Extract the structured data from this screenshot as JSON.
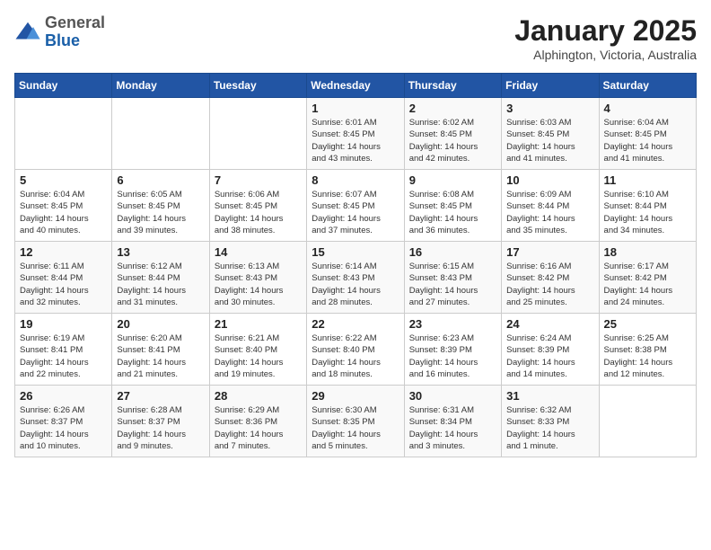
{
  "logo": {
    "general": "General",
    "blue": "Blue"
  },
  "title": "January 2025",
  "subtitle": "Alphington, Victoria, Australia",
  "days_of_week": [
    "Sunday",
    "Monday",
    "Tuesday",
    "Wednesday",
    "Thursday",
    "Friday",
    "Saturday"
  ],
  "weeks": [
    [
      {
        "day": "",
        "info": ""
      },
      {
        "day": "",
        "info": ""
      },
      {
        "day": "",
        "info": ""
      },
      {
        "day": "1",
        "info": "Sunrise: 6:01 AM\nSunset: 8:45 PM\nDaylight: 14 hours\nand 43 minutes."
      },
      {
        "day": "2",
        "info": "Sunrise: 6:02 AM\nSunset: 8:45 PM\nDaylight: 14 hours\nand 42 minutes."
      },
      {
        "day": "3",
        "info": "Sunrise: 6:03 AM\nSunset: 8:45 PM\nDaylight: 14 hours\nand 41 minutes."
      },
      {
        "day": "4",
        "info": "Sunrise: 6:04 AM\nSunset: 8:45 PM\nDaylight: 14 hours\nand 41 minutes."
      }
    ],
    [
      {
        "day": "5",
        "info": "Sunrise: 6:04 AM\nSunset: 8:45 PM\nDaylight: 14 hours\nand 40 minutes."
      },
      {
        "day": "6",
        "info": "Sunrise: 6:05 AM\nSunset: 8:45 PM\nDaylight: 14 hours\nand 39 minutes."
      },
      {
        "day": "7",
        "info": "Sunrise: 6:06 AM\nSunset: 8:45 PM\nDaylight: 14 hours\nand 38 minutes."
      },
      {
        "day": "8",
        "info": "Sunrise: 6:07 AM\nSunset: 8:45 PM\nDaylight: 14 hours\nand 37 minutes."
      },
      {
        "day": "9",
        "info": "Sunrise: 6:08 AM\nSunset: 8:45 PM\nDaylight: 14 hours\nand 36 minutes."
      },
      {
        "day": "10",
        "info": "Sunrise: 6:09 AM\nSunset: 8:44 PM\nDaylight: 14 hours\nand 35 minutes."
      },
      {
        "day": "11",
        "info": "Sunrise: 6:10 AM\nSunset: 8:44 PM\nDaylight: 14 hours\nand 34 minutes."
      }
    ],
    [
      {
        "day": "12",
        "info": "Sunrise: 6:11 AM\nSunset: 8:44 PM\nDaylight: 14 hours\nand 32 minutes."
      },
      {
        "day": "13",
        "info": "Sunrise: 6:12 AM\nSunset: 8:44 PM\nDaylight: 14 hours\nand 31 minutes."
      },
      {
        "day": "14",
        "info": "Sunrise: 6:13 AM\nSunset: 8:43 PM\nDaylight: 14 hours\nand 30 minutes."
      },
      {
        "day": "15",
        "info": "Sunrise: 6:14 AM\nSunset: 8:43 PM\nDaylight: 14 hours\nand 28 minutes."
      },
      {
        "day": "16",
        "info": "Sunrise: 6:15 AM\nSunset: 8:43 PM\nDaylight: 14 hours\nand 27 minutes."
      },
      {
        "day": "17",
        "info": "Sunrise: 6:16 AM\nSunset: 8:42 PM\nDaylight: 14 hours\nand 25 minutes."
      },
      {
        "day": "18",
        "info": "Sunrise: 6:17 AM\nSunset: 8:42 PM\nDaylight: 14 hours\nand 24 minutes."
      }
    ],
    [
      {
        "day": "19",
        "info": "Sunrise: 6:19 AM\nSunset: 8:41 PM\nDaylight: 14 hours\nand 22 minutes."
      },
      {
        "day": "20",
        "info": "Sunrise: 6:20 AM\nSunset: 8:41 PM\nDaylight: 14 hours\nand 21 minutes."
      },
      {
        "day": "21",
        "info": "Sunrise: 6:21 AM\nSunset: 8:40 PM\nDaylight: 14 hours\nand 19 minutes."
      },
      {
        "day": "22",
        "info": "Sunrise: 6:22 AM\nSunset: 8:40 PM\nDaylight: 14 hours\nand 18 minutes."
      },
      {
        "day": "23",
        "info": "Sunrise: 6:23 AM\nSunset: 8:39 PM\nDaylight: 14 hours\nand 16 minutes."
      },
      {
        "day": "24",
        "info": "Sunrise: 6:24 AM\nSunset: 8:39 PM\nDaylight: 14 hours\nand 14 minutes."
      },
      {
        "day": "25",
        "info": "Sunrise: 6:25 AM\nSunset: 8:38 PM\nDaylight: 14 hours\nand 12 minutes."
      }
    ],
    [
      {
        "day": "26",
        "info": "Sunrise: 6:26 AM\nSunset: 8:37 PM\nDaylight: 14 hours\nand 10 minutes."
      },
      {
        "day": "27",
        "info": "Sunrise: 6:28 AM\nSunset: 8:37 PM\nDaylight: 14 hours\nand 9 minutes."
      },
      {
        "day": "28",
        "info": "Sunrise: 6:29 AM\nSunset: 8:36 PM\nDaylight: 14 hours\nand 7 minutes."
      },
      {
        "day": "29",
        "info": "Sunrise: 6:30 AM\nSunset: 8:35 PM\nDaylight: 14 hours\nand 5 minutes."
      },
      {
        "day": "30",
        "info": "Sunrise: 6:31 AM\nSunset: 8:34 PM\nDaylight: 14 hours\nand 3 minutes."
      },
      {
        "day": "31",
        "info": "Sunrise: 6:32 AM\nSunset: 8:33 PM\nDaylight: 14 hours\nand 1 minute."
      },
      {
        "day": "",
        "info": ""
      }
    ]
  ]
}
